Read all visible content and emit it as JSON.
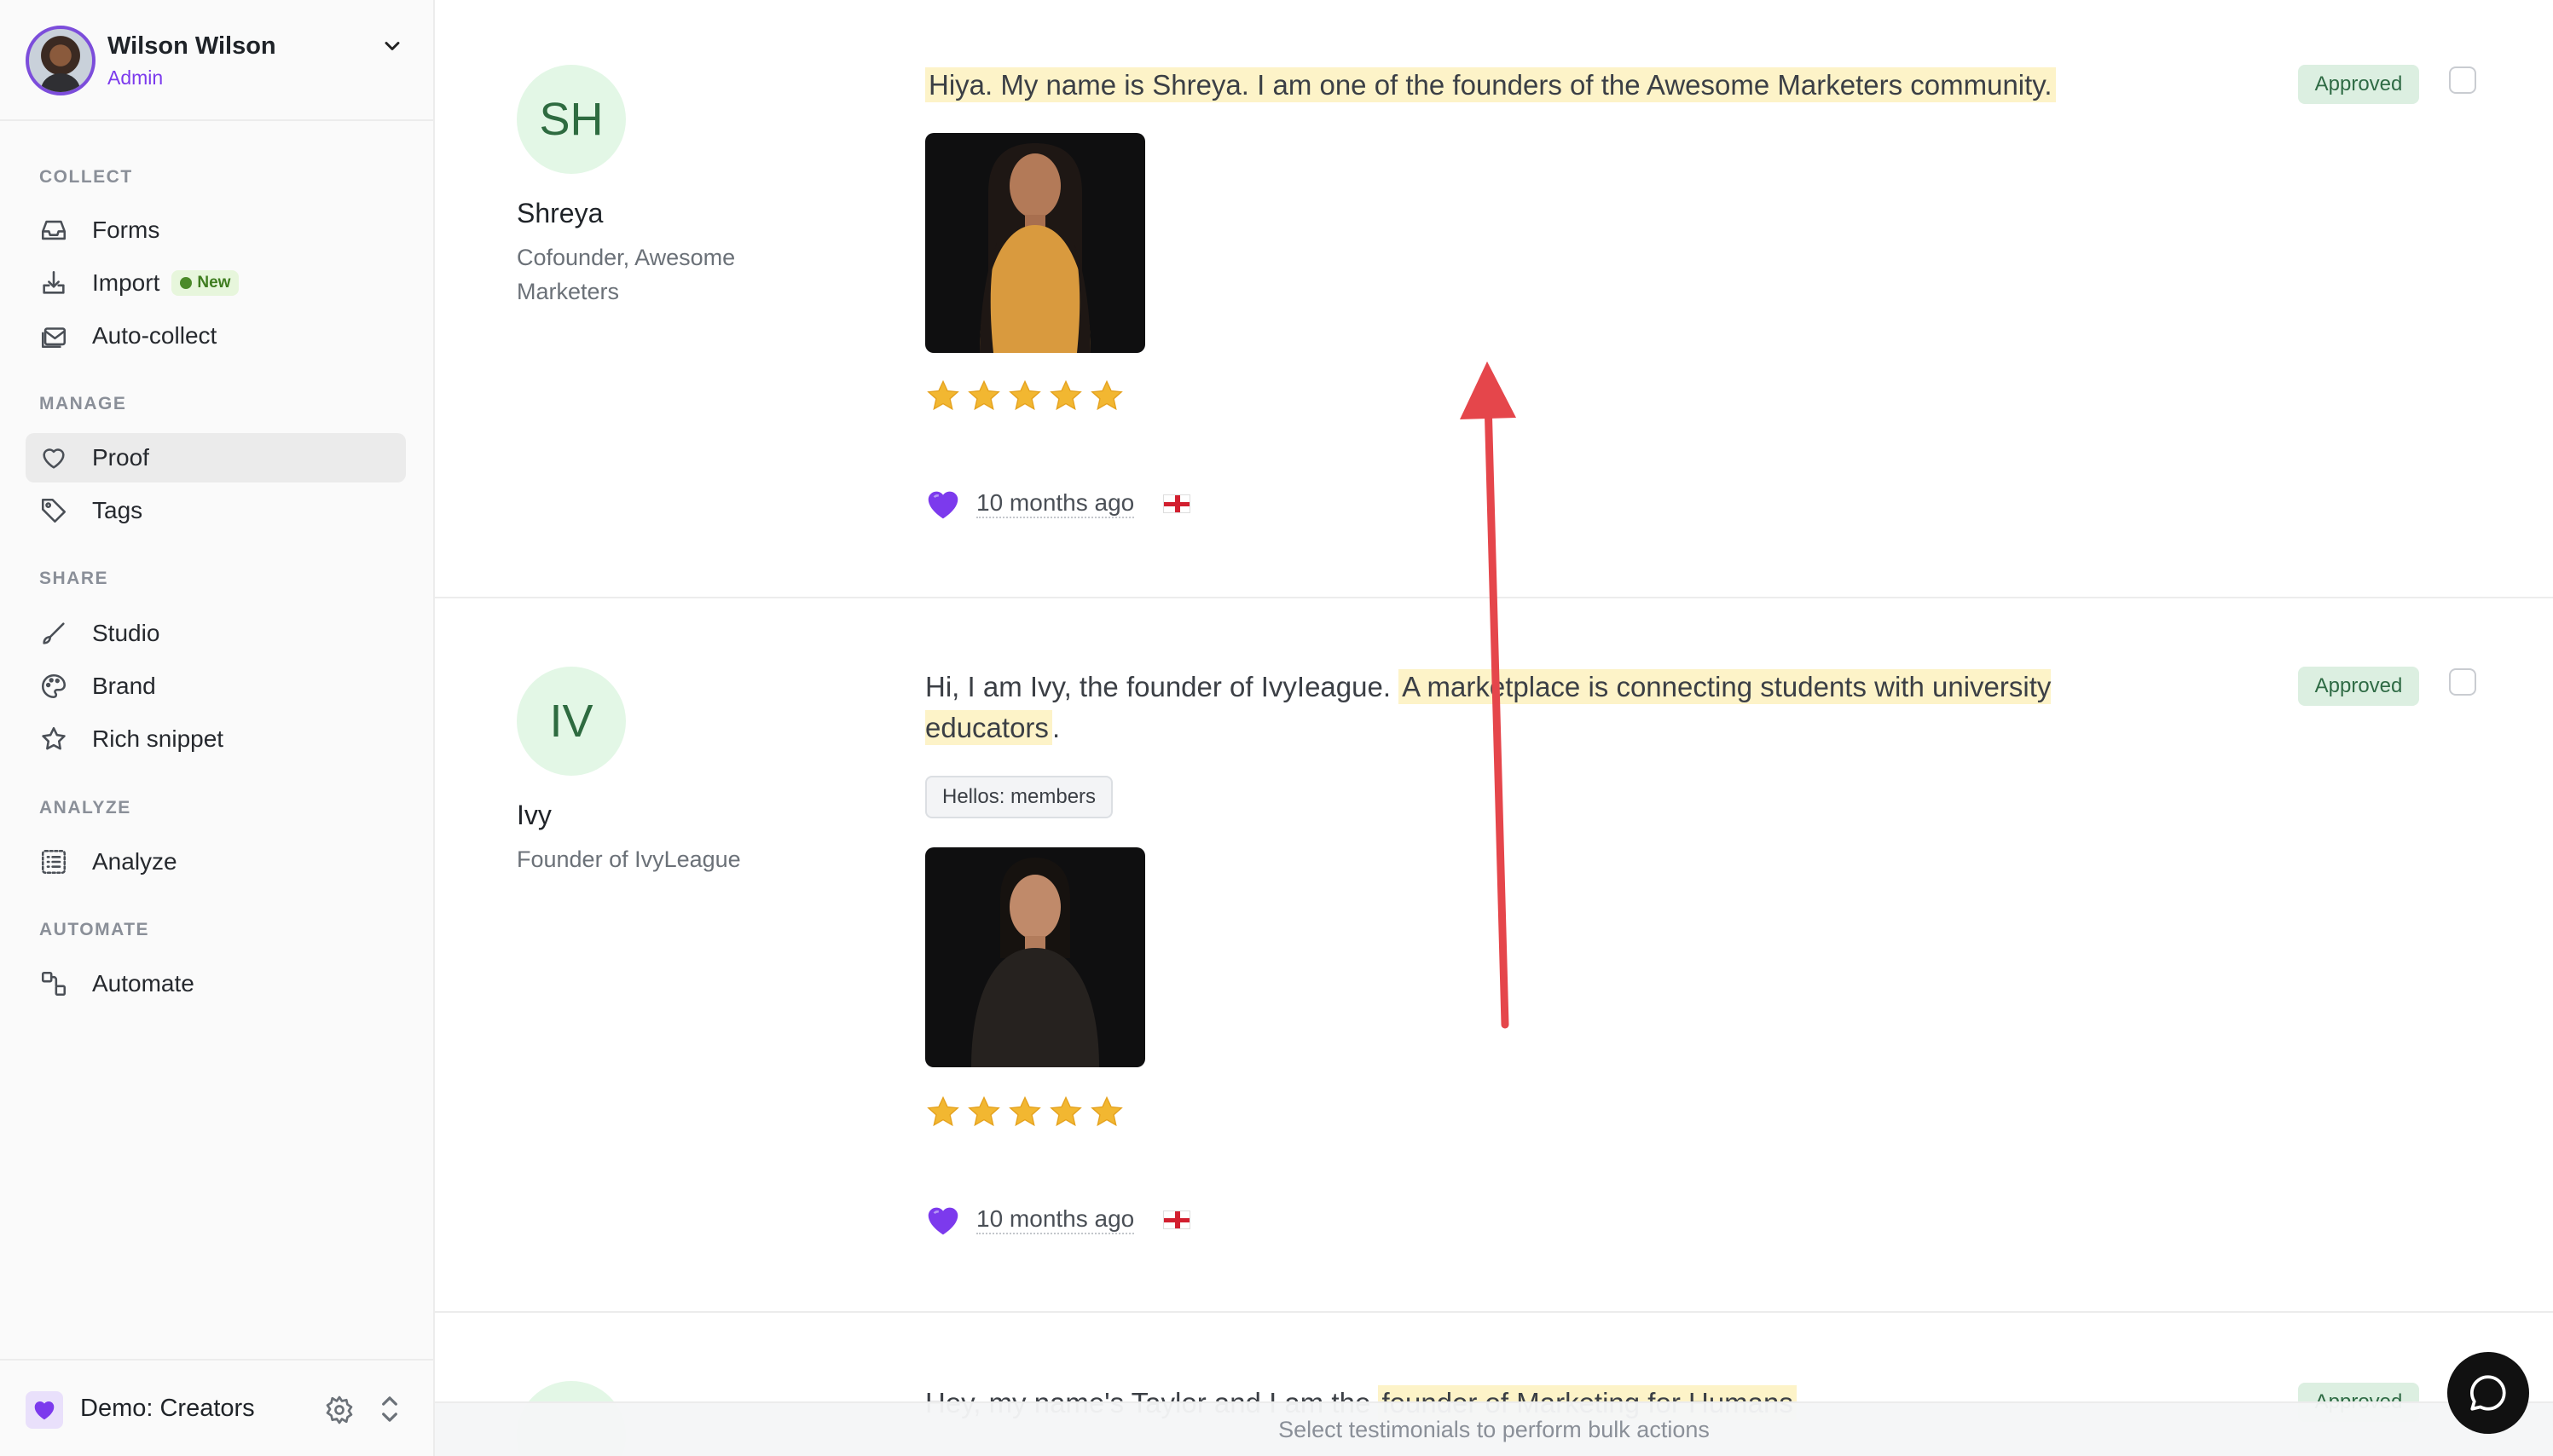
{
  "user": {
    "name": "Wilson Wilson",
    "role": "Admin"
  },
  "sidebar": {
    "sections": [
      {
        "title": "COLLECT"
      },
      {
        "title": "MANAGE"
      },
      {
        "title": "SHARE"
      },
      {
        "title": "ANALYZE"
      },
      {
        "title": "AUTOMATE"
      }
    ],
    "items": {
      "forms": {
        "label": "Forms",
        "icon": "inbox-icon"
      },
      "import": {
        "label": "Import",
        "icon": "import-icon",
        "badge": "New"
      },
      "autocollect": {
        "label": "Auto-collect",
        "icon": "mail-stack-icon"
      },
      "proof": {
        "label": "Proof",
        "icon": "heart-icon",
        "active": true
      },
      "tags": {
        "label": "Tags",
        "icon": "tag-icon"
      },
      "studio": {
        "label": "Studio",
        "icon": "brush-icon"
      },
      "brand": {
        "label": "Brand",
        "icon": "palette-icon"
      },
      "richsnippet": {
        "label": "Rich snippet",
        "icon": "star-icon"
      },
      "analyze": {
        "label": "Analyze",
        "icon": "list-icon"
      },
      "automate": {
        "label": "Automate",
        "icon": "flow-icon"
      }
    },
    "workspace": {
      "name": "Demo: Creators"
    }
  },
  "testimonials": [
    {
      "initials": "SH",
      "name": "Shreya",
      "title": "Cofounder, Awesome Marketers",
      "quote": "Hiya. My name is Shreya. I am one of the founders of the Awesome Marketers community.",
      "status": "Approved",
      "rating": 5,
      "time": "10 months ago"
    },
    {
      "initials": "IV",
      "name": "Ivy",
      "title": "Founder of IvyLeague",
      "quote_plain": "Hi, I am Ivy, the founder of IvyIeague.",
      "quote_highlight": "A marketplace is connecting students with university educators",
      "quote_end": ".",
      "tag": "Hellos: members",
      "status": "Approved",
      "rating": 5,
      "time": "10 months ago"
    },
    {
      "quote_plain": "Hey, my name's Taylor and I am the",
      "quote_highlight": "founder of Marketing for Humans",
      "status": "Approved"
    }
  ],
  "bulk_bar": {
    "text": "Select testimonials to perform bulk actions"
  },
  "colors": {
    "accent": "#7c3aed",
    "approved_bg": "#dcefe1",
    "highlight": "#fdf3c8",
    "arrow": "#e5464b"
  }
}
